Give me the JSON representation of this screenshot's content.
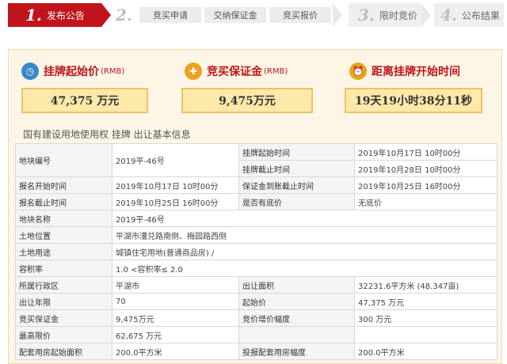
{
  "steps": {
    "s1_num": "1.",
    "s1_label": "发布公告",
    "s2_num": "2.",
    "s2_sub": [
      "竞买申请",
      "交纳保证金",
      "竞买报价"
    ],
    "s3_num": "3.",
    "s3_label": "限时竞价",
    "s4_num": "4.",
    "s4_label": "公布结果"
  },
  "metrics": {
    "start_price_title": "挂牌起始价",
    "start_price_unit": "(RMB)",
    "start_price_value": "47,375 万元",
    "deposit_title": "竞买保证金",
    "deposit_unit": "(RMB)",
    "deposit_value": "9,475万元",
    "countdown_title": "距离挂牌开始时间",
    "countdown_value": "19天19小时38分11秒"
  },
  "section_title": "国有建设用地使用权 挂牌 出让基本信息",
  "table": {
    "r1": {
      "k1": "地块编号",
      "v1": "2019平-46号",
      "k2a": "挂牌起始时间",
      "v2a": "2019年10月17日 10时00分",
      "k2b": "挂牌截止时间",
      "v2b": "2019年10月28日 10时00分"
    },
    "r2": {
      "k1": "报名开始时间",
      "v1": "2019年10月17日 10时00分",
      "k2": "保证金到账截止时间",
      "v2": "2019年10月25日 16时00分"
    },
    "r3": {
      "k1": "报名截止时间",
      "v1": "2019年10月25日 16时00分",
      "k2": "是否有底价",
      "v2": "无底价"
    },
    "r4": {
      "k1": "地块名称",
      "v1": "2019平-46号"
    },
    "r5": {
      "k1": "土地位置",
      "v1": "平湖市漕兑路南侧、梅园路西侧"
    },
    "r6": {
      "k1": "土地用途",
      "v1": "城镇住宅用地(普通商品房) /"
    },
    "r7": {
      "k1": "容积率",
      "v1": "1.0 <容积率≤ 2.0"
    },
    "r8": {
      "k1": "所属行政区",
      "v1": "平湖市",
      "k2": "出让面积",
      "v2": "32231.6平方米 (48.347亩)"
    },
    "r9": {
      "k1": "出让年限",
      "v1": "70",
      "k2": "起始价",
      "v2": "47,375 万元"
    },
    "r10": {
      "k1": "竞买保证金",
      "v1": "9,475万元",
      "k2": "竞价增价幅度",
      "v2": "300 万元"
    },
    "r11": {
      "k1": "最高限价",
      "v1": "62,675 万元",
      "k2": "",
      "v2": ""
    },
    "r12": {
      "k1": "配套用房起始面积",
      "v1": "200.0平方米",
      "k2": "投报配套用房幅度",
      "v2": "200.0平方米"
    }
  },
  "colors": {
    "accent": "#c0141c",
    "panel_bg": "#fdf6e6",
    "value_box": "#fde9a9"
  },
  "icons": {
    "price": "stopwatch-icon",
    "deposit": "hand-coins-icon",
    "countdown": "alarm-clock-icon"
  }
}
